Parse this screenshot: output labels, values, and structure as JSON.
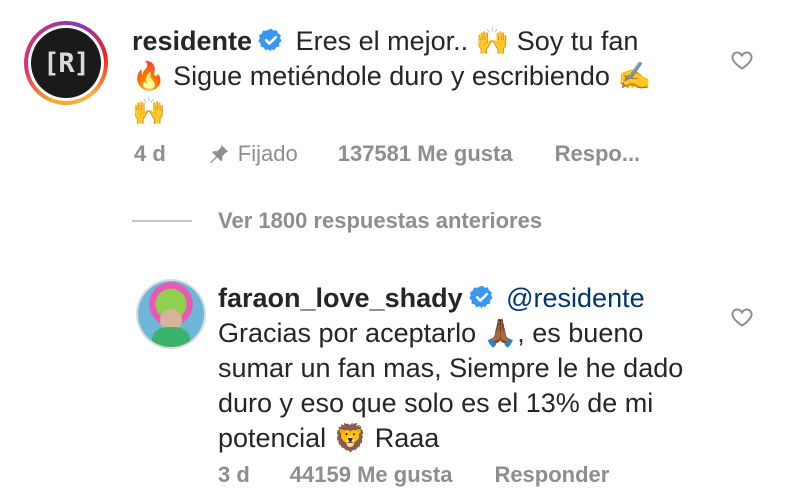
{
  "comment1": {
    "username": "residente",
    "avatar_text": "[R]",
    "text_part1": "Eres el mejor..",
    "emoji1": "🙌",
    "text_part2": "Soy tu fan",
    "emoji2": "🔥",
    "text_part3": "Sigue metiéndole duro  y escribiendo",
    "emoji3": "✍️",
    "emoji4": "🙌",
    "time": "4 d",
    "pinned_label": "Fijado",
    "likes": "137581 Me gusta",
    "reply_label": "Respo..."
  },
  "view_replies": "Ver 1800 respuestas anteriores",
  "comment2": {
    "username": "faraon_love_shady",
    "mention": "@residente",
    "text_part1": "Gracias por aceptarlo",
    "emoji1": "🙏🏾",
    "text_part2": ", es bueno sumar un fan mas, Siempre le he dado duro y eso que solo es el 13% de mi potencial",
    "emoji2": "🦁",
    "text_part3": "Raaa",
    "time": "3 d",
    "likes": "44159 Me gusta",
    "reply_label": "Responder"
  },
  "colors": {
    "verified": "#3897f0",
    "meta": "#8e8e8e",
    "mention": "#00376b"
  },
  "icons": {
    "verified": "verified-badge-icon",
    "like": "heart-outline-icon",
    "pin": "pin-icon"
  }
}
